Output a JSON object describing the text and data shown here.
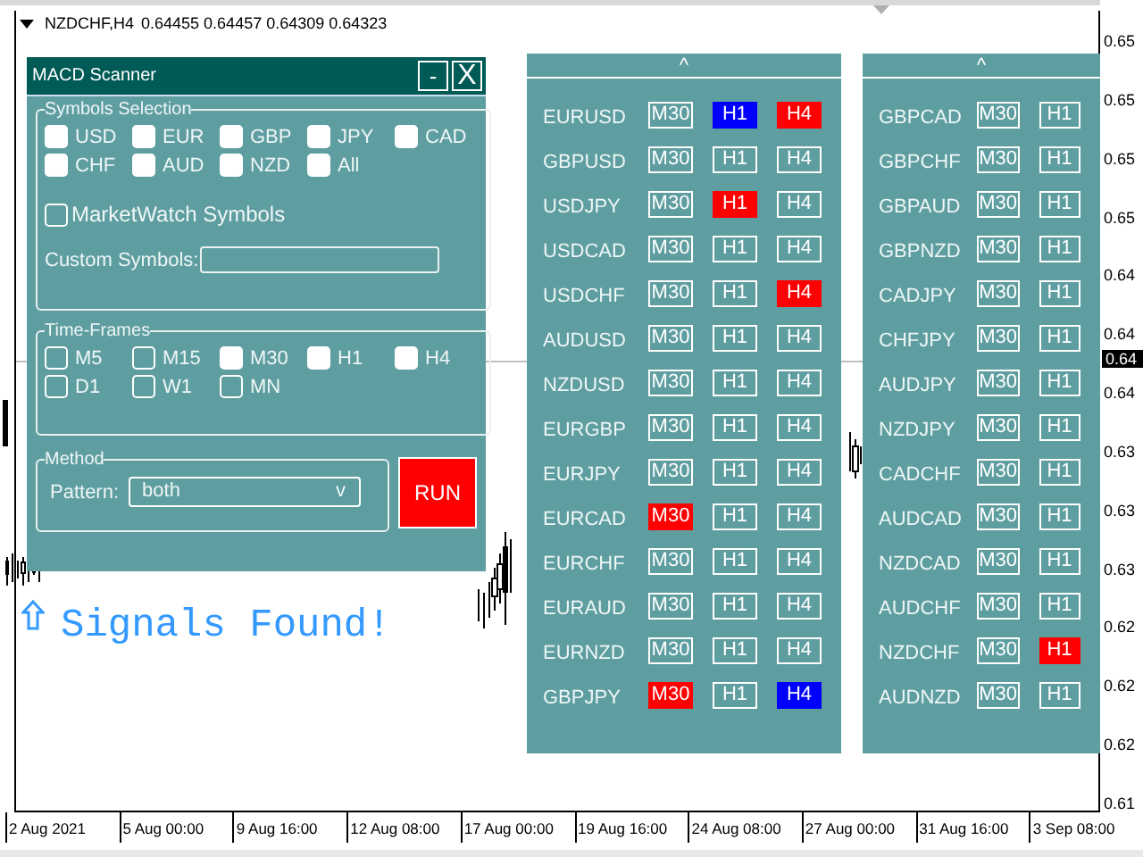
{
  "chart_header": {
    "symbol": "NZDCHF,H4",
    "quotes": "0.64455 0.64457 0.64309 0.64323"
  },
  "price_axis": [
    "0.65",
    "0.65",
    "0.65",
    "0.65",
    "0.64",
    "0.64",
    "0.64",
    "0.63",
    "0.63",
    "0.63",
    "0.62",
    "0.62",
    "0.62",
    "0.61"
  ],
  "current_price": "0.64",
  "date_axis": [
    "2 Aug 2021",
    "5 Aug 00:00",
    "9 Aug 16:00",
    "12 Aug 08:00",
    "17 Aug 00:00",
    "19 Aug 16:00",
    "24 Aug 08:00",
    "27 Aug 00:00",
    "31 Aug 16:00",
    "3 Sep 08:00"
  ],
  "scanner": {
    "title": "MACD Scanner",
    "minimize": "-",
    "close": "X",
    "symbols_group": "Symbols Selection",
    "currencies": [
      {
        "label": "USD",
        "checked": true
      },
      {
        "label": "EUR",
        "checked": true
      },
      {
        "label": "GBP",
        "checked": true
      },
      {
        "label": "JPY",
        "checked": true
      },
      {
        "label": "CAD",
        "checked": true
      },
      {
        "label": "CHF",
        "checked": true
      },
      {
        "label": "AUD",
        "checked": true
      },
      {
        "label": "NZD",
        "checked": true
      },
      {
        "label": "All",
        "checked": true
      }
    ],
    "marketwatch": {
      "label": "MarketWatch Symbols",
      "checked": false
    },
    "custom_symbols": {
      "label": "Custom Symbols:"
    },
    "timeframes_group": "Time-Frames",
    "timeframes": [
      {
        "label": "M5",
        "checked": false
      },
      {
        "label": "M15",
        "checked": false
      },
      {
        "label": "M30",
        "checked": true
      },
      {
        "label": "H1",
        "checked": true
      },
      {
        "label": "H4",
        "checked": true
      },
      {
        "label": "D1",
        "checked": false
      },
      {
        "label": "W1",
        "checked": false
      },
      {
        "label": "MN",
        "checked": false
      }
    ],
    "method_group": "Method",
    "pattern": {
      "label": "Pattern:",
      "value": "both",
      "caret": "v"
    },
    "run_button": "RUN"
  },
  "signals_found": "Signals Found!",
  "signal_panels": [
    {
      "scroll_up": "^",
      "rows": [
        {
          "symbol": "EURUSD",
          "cells": [
            {
              "label": "M30"
            },
            {
              "label": "H1",
              "color": "#0000ff"
            },
            {
              "label": "H4",
              "color": "#ff0000"
            }
          ]
        },
        {
          "symbol": "GBPUSD",
          "cells": [
            {
              "label": "M30"
            },
            {
              "label": "H1"
            },
            {
              "label": "H4"
            }
          ]
        },
        {
          "symbol": "USDJPY",
          "cells": [
            {
              "label": "M30"
            },
            {
              "label": "H1",
              "color": "#ff0000"
            },
            {
              "label": "H4"
            }
          ]
        },
        {
          "symbol": "USDCAD",
          "cells": [
            {
              "label": "M30"
            },
            {
              "label": "H1"
            },
            {
              "label": "H4"
            }
          ]
        },
        {
          "symbol": "USDCHF",
          "cells": [
            {
              "label": "M30"
            },
            {
              "label": "H1"
            },
            {
              "label": "H4",
              "color": "#ff0000"
            }
          ]
        },
        {
          "symbol": "AUDUSD",
          "cells": [
            {
              "label": "M30"
            },
            {
              "label": "H1"
            },
            {
              "label": "H4"
            }
          ]
        },
        {
          "symbol": "NZDUSD",
          "cells": [
            {
              "label": "M30"
            },
            {
              "label": "H1"
            },
            {
              "label": "H4"
            }
          ]
        },
        {
          "symbol": "EURGBP",
          "cells": [
            {
              "label": "M30"
            },
            {
              "label": "H1"
            },
            {
              "label": "H4"
            }
          ]
        },
        {
          "symbol": "EURJPY",
          "cells": [
            {
              "label": "M30"
            },
            {
              "label": "H1"
            },
            {
              "label": "H4"
            }
          ]
        },
        {
          "symbol": "EURCAD",
          "cells": [
            {
              "label": "M30",
              "color": "#ff0000"
            },
            {
              "label": "H1"
            },
            {
              "label": "H4"
            }
          ]
        },
        {
          "symbol": "EURCHF",
          "cells": [
            {
              "label": "M30"
            },
            {
              "label": "H1"
            },
            {
              "label": "H4"
            }
          ]
        },
        {
          "symbol": "EURAUD",
          "cells": [
            {
              "label": "M30"
            },
            {
              "label": "H1"
            },
            {
              "label": "H4"
            }
          ]
        },
        {
          "symbol": "EURNZD",
          "cells": [
            {
              "label": "M30"
            },
            {
              "label": "H1"
            },
            {
              "label": "H4"
            }
          ]
        },
        {
          "symbol": "GBPJPY",
          "cells": [
            {
              "label": "M30",
              "color": "#ff0000"
            },
            {
              "label": "H1"
            },
            {
              "label": "H4",
              "color": "#0000ff"
            }
          ]
        }
      ]
    },
    {
      "scroll_up": "^",
      "rows": [
        {
          "symbol": "GBPCAD",
          "cells": [
            {
              "label": "M30"
            },
            {
              "label": "H1"
            }
          ]
        },
        {
          "symbol": "GBPCHF",
          "cells": [
            {
              "label": "M30"
            },
            {
              "label": "H1"
            }
          ]
        },
        {
          "symbol": "GBPAUD",
          "cells": [
            {
              "label": "M30"
            },
            {
              "label": "H1"
            }
          ]
        },
        {
          "symbol": "GBPNZD",
          "cells": [
            {
              "label": "M30"
            },
            {
              "label": "H1"
            }
          ]
        },
        {
          "symbol": "CADJPY",
          "cells": [
            {
              "label": "M30"
            },
            {
              "label": "H1"
            }
          ]
        },
        {
          "symbol": "CHFJPY",
          "cells": [
            {
              "label": "M30"
            },
            {
              "label": "H1"
            }
          ]
        },
        {
          "symbol": "AUDJPY",
          "cells": [
            {
              "label": "M30"
            },
            {
              "label": "H1"
            }
          ]
        },
        {
          "symbol": "NZDJPY",
          "cells": [
            {
              "label": "M30"
            },
            {
              "label": "H1"
            }
          ]
        },
        {
          "symbol": "CADCHF",
          "cells": [
            {
              "label": "M30"
            },
            {
              "label": "H1"
            }
          ]
        },
        {
          "symbol": "AUDCAD",
          "cells": [
            {
              "label": "M30"
            },
            {
              "label": "H1"
            }
          ]
        },
        {
          "symbol": "NZDCAD",
          "cells": [
            {
              "label": "M30"
            },
            {
              "label": "H1"
            }
          ]
        },
        {
          "symbol": "AUDCHF",
          "cells": [
            {
              "label": "M30"
            },
            {
              "label": "H1"
            }
          ]
        },
        {
          "symbol": "NZDCHF",
          "cells": [
            {
              "label": "M30"
            },
            {
              "label": "H1",
              "color": "#ff0000"
            }
          ]
        },
        {
          "symbol": "AUDNZD",
          "cells": [
            {
              "label": "M30"
            },
            {
              "label": "H1"
            }
          ]
        }
      ]
    }
  ]
}
